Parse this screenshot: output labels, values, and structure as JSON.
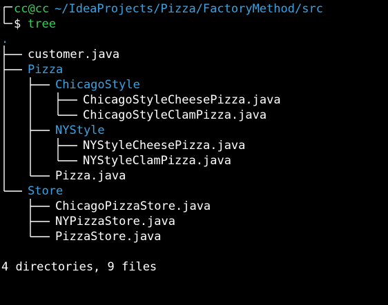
{
  "prompt": {
    "user_host": "cc@cc",
    "cwd": "~/IdeaProjects/Pizza/FactoryMethod/src",
    "symbol": "$",
    "command": "tree"
  },
  "tree": {
    "root": ".",
    "entries": [
      {
        "name": "customer.java",
        "type": "file"
      },
      {
        "name": "Pizza",
        "type": "dir"
      },
      {
        "name": "ChicagoStyle",
        "type": "dir"
      },
      {
        "name": "ChicagoStyleCheesePizza.java",
        "type": "file"
      },
      {
        "name": "ChicagoStyleClamPizza.java",
        "type": "file"
      },
      {
        "name": "NYStyle",
        "type": "dir"
      },
      {
        "name": "NYStyleCheesePizza.java",
        "type": "file"
      },
      {
        "name": "NYStyleClamPizza.java",
        "type": "file"
      },
      {
        "name": "Pizza.java",
        "type": "file"
      },
      {
        "name": "Store",
        "type": "dir"
      },
      {
        "name": "ChicagoPizzaStore.java",
        "type": "file"
      },
      {
        "name": "NYPizzaStore.java",
        "type": "file"
      },
      {
        "name": "PizzaStore.java",
        "type": "file"
      }
    ],
    "summary": "4 directories, 9 files"
  },
  "colors": {
    "background": "#000000",
    "prompt_green": "#34d058",
    "directory_blue": "#3aa3e3",
    "text": "#ffffff"
  }
}
